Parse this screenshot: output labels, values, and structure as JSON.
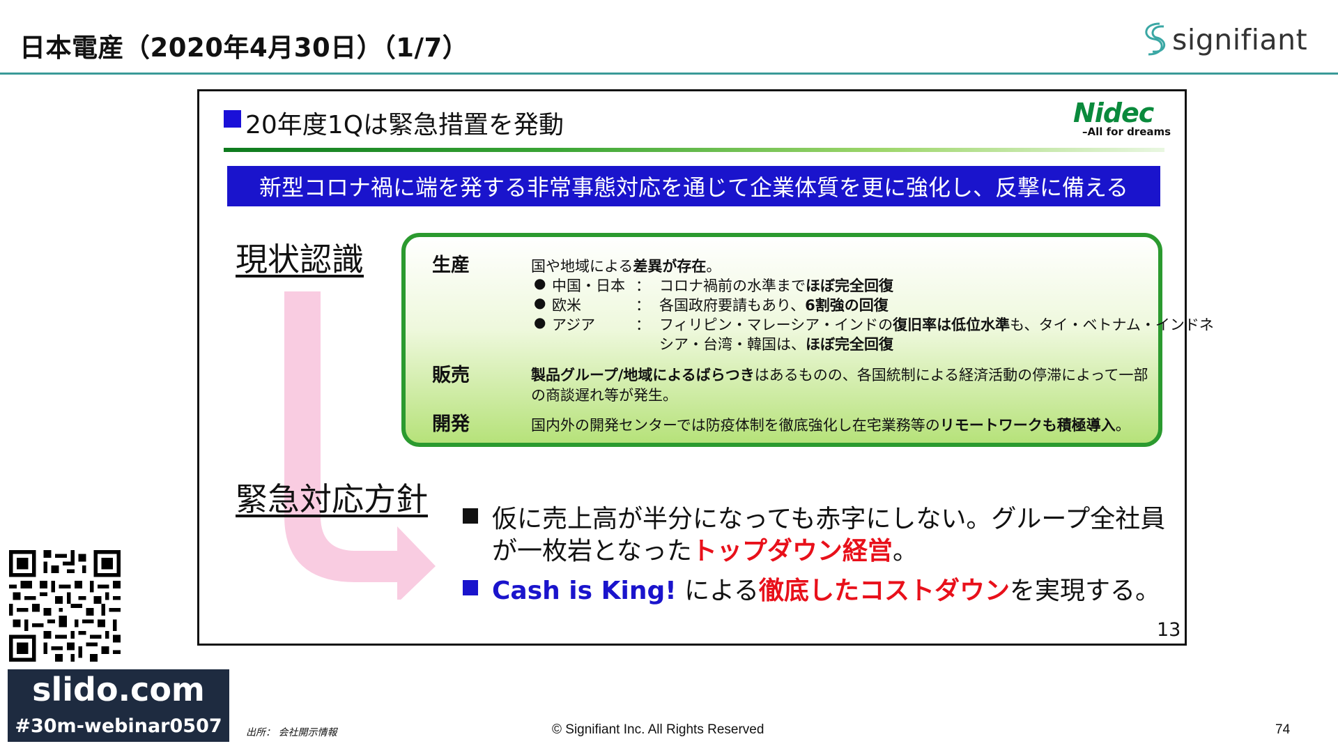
{
  "header": {
    "title": "日本電産（2020年4月30日）（1/7）",
    "brand": "signifiant"
  },
  "slide": {
    "heading": "20年度1Qは緊急措置を発動",
    "logo": {
      "name": "Nidec",
      "tagline": "–All for dreams"
    },
    "banner": "新型コロナ禍に端を発する非常事態対応を通じて企業体質を更に強化し、反撃に備える",
    "label_current": "現状認識",
    "label_policy": "緊急対応方針",
    "status": {
      "production": {
        "label": "生産",
        "intro_a": "国や地域による",
        "intro_b": "差異が存在",
        "intro_c": "。",
        "rows": [
          {
            "region": "中国・日本",
            "colon": "：",
            "text_a": "コロナ禍前の水準まで",
            "text_b": "ほぼ完全回復",
            "text_c": ""
          },
          {
            "region": "欧米",
            "colon": "：",
            "text_a": "各国政府要請もあり、",
            "text_b": "6割強の回復",
            "text_c": ""
          },
          {
            "region": "アジア",
            "colon": "：",
            "text_a": "フィリピン・マレーシア・インドの",
            "text_b": "復旧率は低位水準",
            "text_c": "も、タイ・ベトナム・インドネ"
          }
        ],
        "row3_line2_a": "シア・台湾・韓国は、",
        "row3_line2_b": "ほぼ完全回復"
      },
      "sales": {
        "label": "販売",
        "line1_b": "製品グループ/地域によるばらつき",
        "line1_c": "はあるものの、各国統制による経済活動の停滞によって一部",
        "line2": "の商談遅れ等が発生。"
      },
      "development": {
        "label": "開発",
        "line1_a": "国内外の開発センターでは防疫体制を徹底強化し在宅業務等の",
        "line1_b": "リモートワークも積極導入",
        "line1_c": "。"
      }
    },
    "policy": {
      "p1_line1": "仮に売上高が半分になっても赤字にしない。グループ全社員",
      "p1_line2_a": "が一枚岩となった",
      "p1_line2_b": "トップダウン経営",
      "p1_line2_c": "。",
      "p2_a": "Cash is King!",
      "p2_b": "による",
      "p2_c": "徹底したコストダウン",
      "p2_d": "を実現する。"
    },
    "slide_number": "13"
  },
  "footer": {
    "slido_url": "slido.com",
    "slido_tag": "#30m-webinar0507",
    "source": "出所： 会社開示情報",
    "copyright": "© Signifiant Inc. All Rights Reserved",
    "page_number": "74"
  },
  "colors": {
    "accent_teal": "#3a9a98",
    "banner_blue": "#1a14cc",
    "box_green": "#2b9a2f",
    "highlight_red": "#e8101a",
    "slido_navy": "#1e2b40"
  }
}
